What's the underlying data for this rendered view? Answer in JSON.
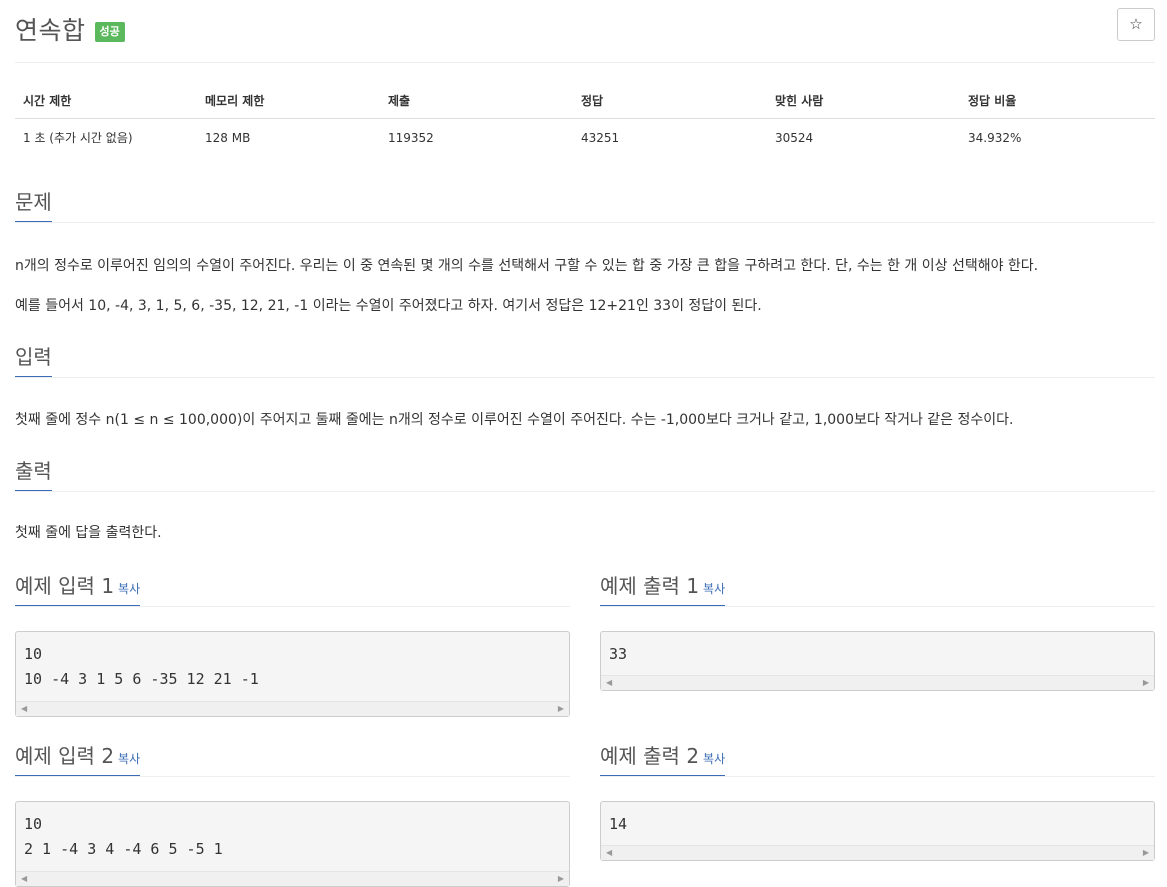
{
  "title": "연속합",
  "badge": "성공",
  "star_label": "☆",
  "stats": {
    "headers": [
      "시간 제한",
      "메모리 제한",
      "제출",
      "정답",
      "맞힌 사람",
      "정답 비율"
    ],
    "values": [
      "1 초 (추가 시간 없음)",
      "128 MB",
      "119352",
      "43251",
      "30524",
      "34.932%"
    ]
  },
  "sections": {
    "problem": {
      "title": "문제",
      "p1": "n개의 정수로 이루어진 임의의 수열이 주어진다. 우리는 이 중 연속된 몇 개의 수를 선택해서 구할 수 있는 합 중 가장 큰 합을 구하려고 한다. 단, 수는 한 개 이상 선택해야 한다.",
      "p2": "예를 들어서 10, -4, 3, 1, 5, 6, -35, 12, 21, -1 이라는 수열이 주어졌다고 하자. 여기서 정답은 12+21인 33이 정답이 된다."
    },
    "input": {
      "title": "입력",
      "p1": "첫째 줄에 정수 n(1 ≤ n ≤ 100,000)이 주어지고 둘째 줄에는 n개의 정수로 이루어진 수열이 주어진다. 수는 -1,000보다 크거나 같고, 1,000보다 작거나 같은 정수이다."
    },
    "output": {
      "title": "출력",
      "p1": "첫째 줄에 답을 출력한다."
    }
  },
  "samples": {
    "copy_label": "복사",
    "in1": {
      "title": "예제 입력 1",
      "text": "10\n10 -4 3 1 5 6 -35 12 21 -1"
    },
    "out1": {
      "title": "예제 출력 1",
      "text": "33"
    },
    "in2": {
      "title": "예제 입력 2",
      "text": "10\n2 1 -4 3 4 -4 6 5 -5 1"
    },
    "out2": {
      "title": "예제 출력 2",
      "text": "14"
    }
  },
  "icons": {
    "star": "star-icon",
    "scroll_left": "scroll-left-arrow-icon",
    "scroll_right": "scroll-right-arrow-icon"
  },
  "colors": {
    "accent": "#3a6cb5",
    "success_badge": "#5cb85c"
  }
}
